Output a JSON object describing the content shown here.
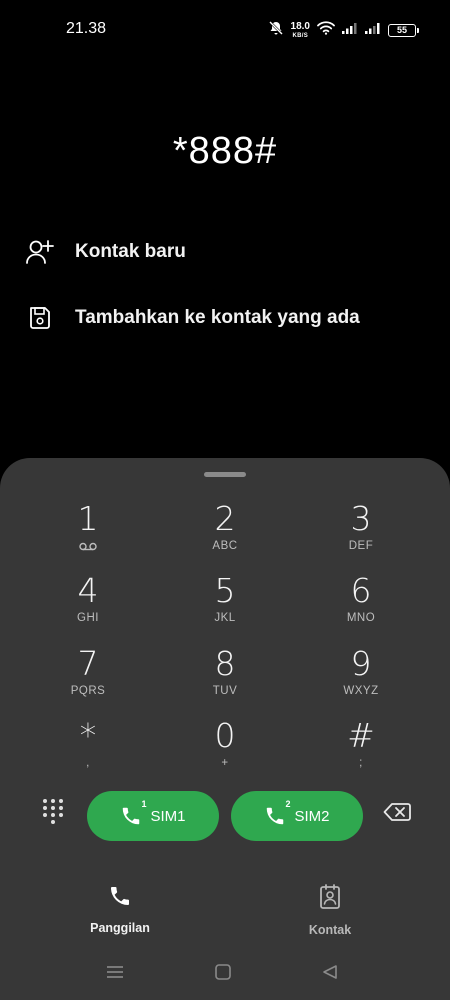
{
  "status_bar": {
    "time": "21.38",
    "net_speed_value": "18.0",
    "net_speed_unit": "KB/S",
    "battery": "55",
    "icons": [
      "mute-icon",
      "wifi-icon",
      "signal-icon",
      "signal-icon"
    ]
  },
  "dialer": {
    "number": "*888#"
  },
  "actions": {
    "new_contact": "Kontak baru",
    "add_to_existing": "Tambahkan ke kontak yang ada"
  },
  "keypad": {
    "keys": [
      {
        "digit": "1",
        "letters": ""
      },
      {
        "digit": "2",
        "letters": "ABC"
      },
      {
        "digit": "3",
        "letters": "DEF"
      },
      {
        "digit": "4",
        "letters": "GHI"
      },
      {
        "digit": "5",
        "letters": "JKL"
      },
      {
        "digit": "6",
        "letters": "MNO"
      },
      {
        "digit": "7",
        "letters": "PQRS"
      },
      {
        "digit": "8",
        "letters": "TUV"
      },
      {
        "digit": "9",
        "letters": "WXYZ"
      },
      {
        "digit": "*",
        "letters": ","
      },
      {
        "digit": "0",
        "letters": "+"
      },
      {
        "digit": "#",
        "letters": ";"
      }
    ]
  },
  "call_buttons": {
    "sim1_label": "SIM1",
    "sim1_badge": "1",
    "sim2_label": "SIM2",
    "sim2_badge": "2"
  },
  "bottom_nav": {
    "calls_label": "Panggilan",
    "contacts_label": "Kontak"
  },
  "colors": {
    "background": "#000000",
    "panel": "#373737",
    "call_green": "#2fa84f"
  }
}
